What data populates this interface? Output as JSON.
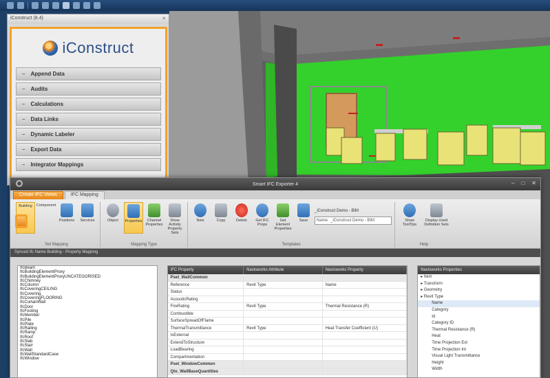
{
  "plugin_panel": {
    "title": "iConstruct (8.4)",
    "logo_text": "iConstruct",
    "items": [
      {
        "label": "Append Data"
      },
      {
        "label": "Audits"
      },
      {
        "label": "Calculations"
      },
      {
        "label": "Data Links"
      },
      {
        "label": "Dynamic Labeler"
      },
      {
        "label": "Export Data"
      },
      {
        "label": "Integrator Mappings"
      }
    ]
  },
  "dialog": {
    "title": "Smart IFC Exporter 4",
    "tabs": [
      {
        "label": "Create IFC Views",
        "active": true
      },
      {
        "label": "IFC Mapping",
        "active": false
      }
    ],
    "ribbon_groups": [
      {
        "label": "Set Mapping",
        "buttons": [
          {
            "label": "Building",
            "icon": "building-icon",
            "selected": true
          },
          {
            "label": "Component",
            "icon": "component-icon"
          },
          {
            "label": "Positions",
            "icon": "chart-icon"
          },
          {
            "label": "Services",
            "icon": "services-icon"
          }
        ]
      },
      {
        "label": "Mapping Type",
        "buttons": [
          {
            "label": "Object",
            "icon": "eye-icon"
          },
          {
            "label": "Properties",
            "icon": "grid-icon",
            "selected": true
          },
          {
            "label": "Channel Properties",
            "icon": "network-icon"
          },
          {
            "label": "Show Activity Property Sets",
            "icon": "tools-icon"
          }
        ]
      },
      {
        "label": "Templates",
        "buttons": [
          {
            "label": "New",
            "icon": "new-icon"
          },
          {
            "label": "Copy",
            "icon": "copy-icon"
          },
          {
            "label": "Delete",
            "icon": "delete-icon"
          },
          {
            "label": "Get IFC Props",
            "icon": "sync-icon"
          },
          {
            "label": "Get Element Properties",
            "icon": "hierarchy-icon"
          },
          {
            "label": "Save",
            "icon": "save-icon"
          }
        ]
      },
      {
        "label": "Help",
        "buttons": [
          {
            "label": "Show ToolTips",
            "icon": "info-icon"
          },
          {
            "label": "Display Used Definition Sets",
            "icon": "list-icon"
          }
        ]
      }
    ],
    "template_field": {
      "dropdown": "_iConstruct Demo - BIM",
      "name_label": "Name",
      "name_value": "_iConstruct Demo - BIM"
    },
    "subheader": "Synced Ifc Name Building - Property Mapping",
    "element_list": [
      "IfcBeam",
      "IfcBuildingElementProxy",
      "IfcBuildingElementProxyUNCATEGORISED",
      "IfcChimney",
      "IfcColumn",
      "IfcCoveringCEILING",
      "IfcCovering",
      "IfcCoveringFLOORING",
      "IfcCurtainWall",
      "IfcDoor",
      "IfcFooting",
      "IfcMember",
      "IfcPile",
      "IfcPlate",
      "IfcRailing",
      "IfcRamp",
      "IfcRoof",
      "IfcSlab",
      "IfcStair",
      "IfcWall",
      "IfcWallStandardCase",
      "IfcWindow"
    ],
    "grid": {
      "headers": [
        "IFC Property",
        "Navisworks Attribute",
        "Navisworks Property"
      ],
      "rows": [
        {
          "type": "group",
          "cells": [
            "Pset_WallCommon",
            "",
            ""
          ]
        },
        {
          "cells": [
            "Reference",
            "Revit Type",
            "Name"
          ]
        },
        {
          "cells": [
            "Status",
            "",
            ""
          ]
        },
        {
          "cells": [
            "AcousticRating",
            "",
            ""
          ]
        },
        {
          "cells": [
            "FireRating",
            "Revit Type",
            "Thermal Resistance (R)"
          ]
        },
        {
          "cells": [
            "Combustible",
            "",
            ""
          ]
        },
        {
          "cells": [
            "SurfaceSpreadOfFlame",
            "",
            ""
          ]
        },
        {
          "cells": [
            "ThermalTransmittance",
            "Revit Type",
            "Heat Transfer Coefficient (U)"
          ]
        },
        {
          "cells": [
            "IsExternal",
            "",
            ""
          ]
        },
        {
          "cells": [
            "ExtendToStructure",
            "",
            ""
          ]
        },
        {
          "cells": [
            "LoadBearing",
            "",
            ""
          ]
        },
        {
          "cells": [
            "Compartmentation",
            "",
            ""
          ]
        },
        {
          "type": "group",
          "cells": [
            "Pset_WindowCommon",
            "",
            ""
          ]
        },
        {
          "type": "group",
          "cells": [
            "Qto_WallBaseQuantities",
            "",
            ""
          ]
        }
      ]
    },
    "tree": {
      "header": "Navisworks Properties",
      "nodes": [
        {
          "label": "Item",
          "level": 0
        },
        {
          "label": "Transform",
          "level": 0
        },
        {
          "label": "Geometry",
          "level": 0
        },
        {
          "label": "Revit Type",
          "level": 0
        },
        {
          "label": "Name",
          "level": 1,
          "selected": true
        },
        {
          "label": "Category",
          "level": 1
        },
        {
          "label": "Id",
          "level": 1
        },
        {
          "label": "Category ID",
          "level": 1
        },
        {
          "label": "Thermal Resistance (R)",
          "level": 1
        },
        {
          "label": "Heat",
          "level": 1
        },
        {
          "label": "Time Projection Ext",
          "level": 1
        },
        {
          "label": "Time Projection Int",
          "level": 1
        },
        {
          "label": "Visual Light Transmittance",
          "level": 1
        },
        {
          "label": "Height",
          "level": 1
        },
        {
          "label": "Width",
          "level": 1
        }
      ]
    }
  },
  "colors": {
    "accent_orange": "#f3a12b",
    "title_bar": "#3a3a3a",
    "viewport_green": "#34d12c",
    "chair_yellow": "#e9e277"
  }
}
